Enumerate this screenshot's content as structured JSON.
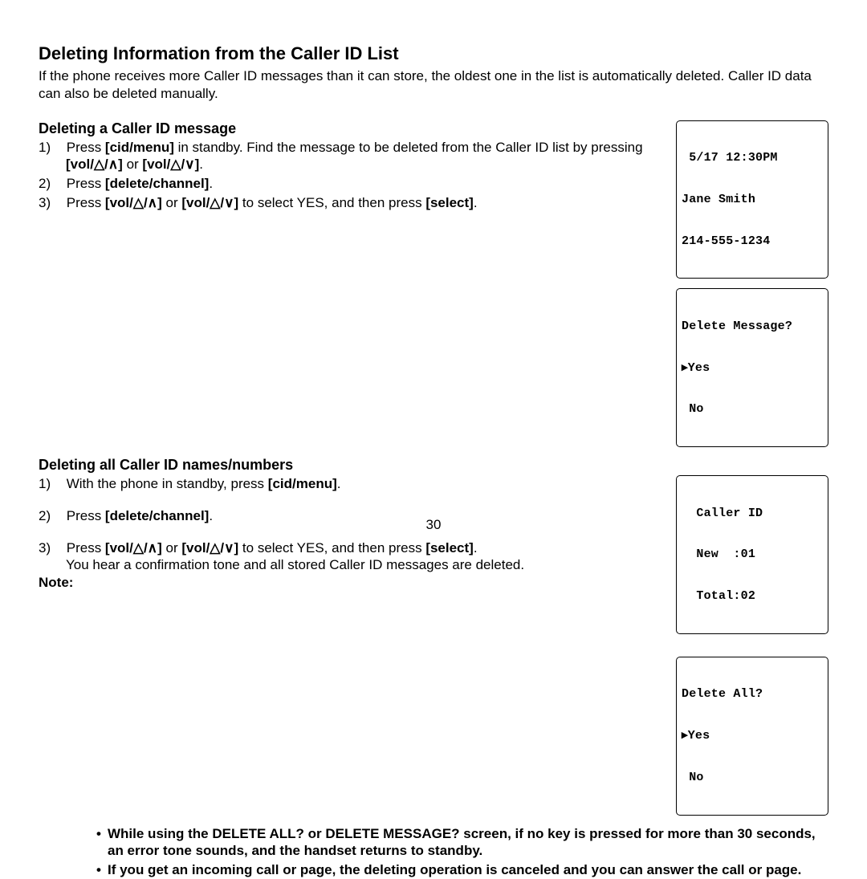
{
  "page_number": "30",
  "h1": "Deleting Information from the Caller ID List",
  "intro": "If the phone receives more Caller ID messages than it can store, the oldest one in the list is automatically deleted. Caller ID data can also be deleted manually.",
  "sectionA": {
    "heading": "Deleting a Caller ID message",
    "steps": {
      "s1a": "Press ",
      "s1b": "[cid/menu]",
      "s1c": " in standby. Find the message to be deleted from the Caller ID list by pressing ",
      "s1d_vol_up": "[vol/△/∧]",
      "s1e": " or ",
      "s1f_vol_dn": "[vol/△/∨]",
      "s1g": ".",
      "s2a": "Press ",
      "s2b": "[delete/channel]",
      "s2c": ".",
      "s3a": "Press ",
      "s3b_vol_up": "[vol/△/∧]",
      "s3c": " or ",
      "s3d_vol_dn": "[vol/△/∨]",
      "s3e": " to select YES, and then press ",
      "s3f": "[select]",
      "s3g": "."
    }
  },
  "sectionB": {
    "heading": "Deleting all Caller ID names/numbers",
    "steps": {
      "s1a": "With the phone in standby, press ",
      "s1b": "[cid/menu]",
      "s1c": ".",
      "s2a": "Press ",
      "s2b": "[delete/channel]",
      "s2c": ".",
      "s3a": "Press ",
      "s3b_vol_up": "[vol/△/∧]",
      "s3c": " or ",
      "s3d_vol_dn": "[vol/△/∨]",
      "s3e": " to select YES, and then press ",
      "s3f": "[select]",
      "s3g": ".",
      "s3h": "You hear a confirmation tone and all stored Caller ID messages are deleted.",
      "note_label": "Note:"
    },
    "notes": {
      "n1": "While using the DELETE ALL? or DELETE MESSAGE? screen, if no key is pressed for more than 30 seconds, an error tone sounds, and the handset returns to standby.",
      "n2": "If you get an incoming call or page, the deleting operation is canceled and you can answer the call or page."
    }
  },
  "lcd1": {
    "line1": " 5/17 12:30PM",
    "line2": "Jane Smith",
    "line3": "214-555-1234"
  },
  "lcd2": {
    "line1": "Delete Message?",
    "line2": "▸Yes",
    "line3": " No"
  },
  "lcd3": {
    "line1": "  Caller ID",
    "line2": "  New  :01",
    "line3": "  Total:02"
  },
  "lcd4": {
    "line1": "Delete All?",
    "line2": "▸Yes",
    "line3": " No"
  }
}
